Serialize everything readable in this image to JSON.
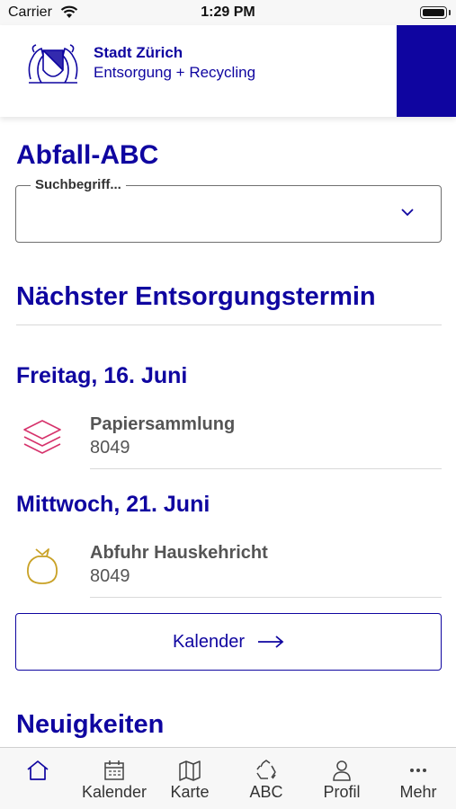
{
  "status_bar": {
    "carrier": "Carrier",
    "time": "1:29 PM",
    "icons": [
      "wifi-icon",
      "battery-icon"
    ]
  },
  "header": {
    "logo_icon": "zurich-crest-icon",
    "title": "Stadt Zürich",
    "subtitle": "Entsorgung + Recycling",
    "brand_color": "#0f05a0"
  },
  "abc": {
    "title": "Abfall-ABC",
    "search_label": "Suchbegriff...",
    "search_value": "",
    "chevron_icon": "chevron-down-icon"
  },
  "next_dates": {
    "title": "Nächster Entsorgungstermin",
    "days": [
      {
        "date": "Freitag, 16. Juni",
        "events": [
          {
            "icon": "paper-stack-icon",
            "icon_color": "#d6336c",
            "name": "Papiersammlung",
            "zip": "8049"
          }
        ]
      },
      {
        "date": "Mittwoch, 21. Juni",
        "events": [
          {
            "icon": "garbage-bag-icon",
            "icon_color": "#c9a227",
            "name": "Abfuhr Hauskehricht",
            "zip": "8049"
          }
        ]
      }
    ],
    "calendar_button": {
      "label": "Kalender",
      "icon": "arrow-right-icon"
    }
  },
  "news": {
    "title": "Neuigkeiten"
  },
  "tabbar": {
    "tabs": [
      {
        "label": "",
        "icon": "home-icon",
        "active": true
      },
      {
        "label": "Kalender",
        "icon": "calendar-icon",
        "active": false
      },
      {
        "label": "Karte",
        "icon": "map-icon",
        "active": false
      },
      {
        "label": "ABC",
        "icon": "recycle-icon",
        "active": false
      },
      {
        "label": "Profil",
        "icon": "profile-icon",
        "active": false
      },
      {
        "label": "Mehr",
        "icon": "more-icon",
        "active": false
      }
    ],
    "active_color": "#0f05a0"
  }
}
